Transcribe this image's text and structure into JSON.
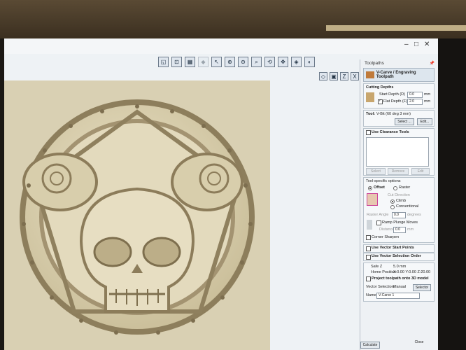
{
  "window": {
    "minimize": "–",
    "maximize": "□",
    "close": "✕"
  },
  "toolbar": {
    "icons": [
      "view-icon",
      "zoom-icon",
      "grid-icon",
      "cut-icon",
      "select-icon",
      "zoom-in-icon",
      "zoom-out-icon",
      "zoom-fit-icon",
      "rotate-icon",
      "pan-icon",
      "material-icon",
      "render-icon"
    ]
  },
  "view_tools": {
    "icons": [
      "view-iso-icon",
      "view-top-icon",
      "view-front-icon",
      "view-x-icon",
      "view-y-icon",
      "view-right-icon"
    ]
  },
  "panel": {
    "title": "Toolpaths",
    "pin": "📌",
    "header": "V-Carve / Engraving Toolpath",
    "cutting_depths": {
      "heading": "Cutting Depths",
      "start_label": "Start Depth (D)",
      "start_value": "0.0",
      "flat_label": "Flat Depth (F)",
      "flat_value": "2.0",
      "unit": "mm"
    },
    "tool": {
      "label": "Tool:",
      "value": "V-Bit (60 deg 3 mm)",
      "select": "Select ...",
      "edit": "Edit..."
    },
    "clearance": {
      "label": "Use Clearance Tools",
      "select": "Select",
      "remove": "Remove",
      "edit": "Edit"
    },
    "tool_options": {
      "heading": "Tool-specific options",
      "offset": "Offset",
      "raster": "Raster",
      "cut_direction": "Cut Direction",
      "climb": "Climb",
      "conventional": "Conventional",
      "raster_angle": "Raster Angle",
      "raster_value": "0.0",
      "degrees": "degrees",
      "ramp": "Ramp Plunge Moves",
      "distance": "Distance",
      "distance_value": "0.0",
      "distance_unit": "mm",
      "corner": "Corner Sharpen"
    },
    "vector_start": "Use Vector Start Points",
    "vector_order": "Use Vector Selection Order",
    "safe_z_label": "Safe Z",
    "safe_z_value": "5.0 mm",
    "home_label": "Home Position",
    "home_value": "X:0.00 Y:0.00 Z:20.00",
    "project": "Project toolpath onto 3D model",
    "vector_selection_label": "Vector Selection:",
    "vector_selection_value": "Manual",
    "selector": "Selector",
    "name_label": "Name:",
    "name_value": "V-Carve 1",
    "calculate": "Calculate",
    "close": "Close"
  }
}
